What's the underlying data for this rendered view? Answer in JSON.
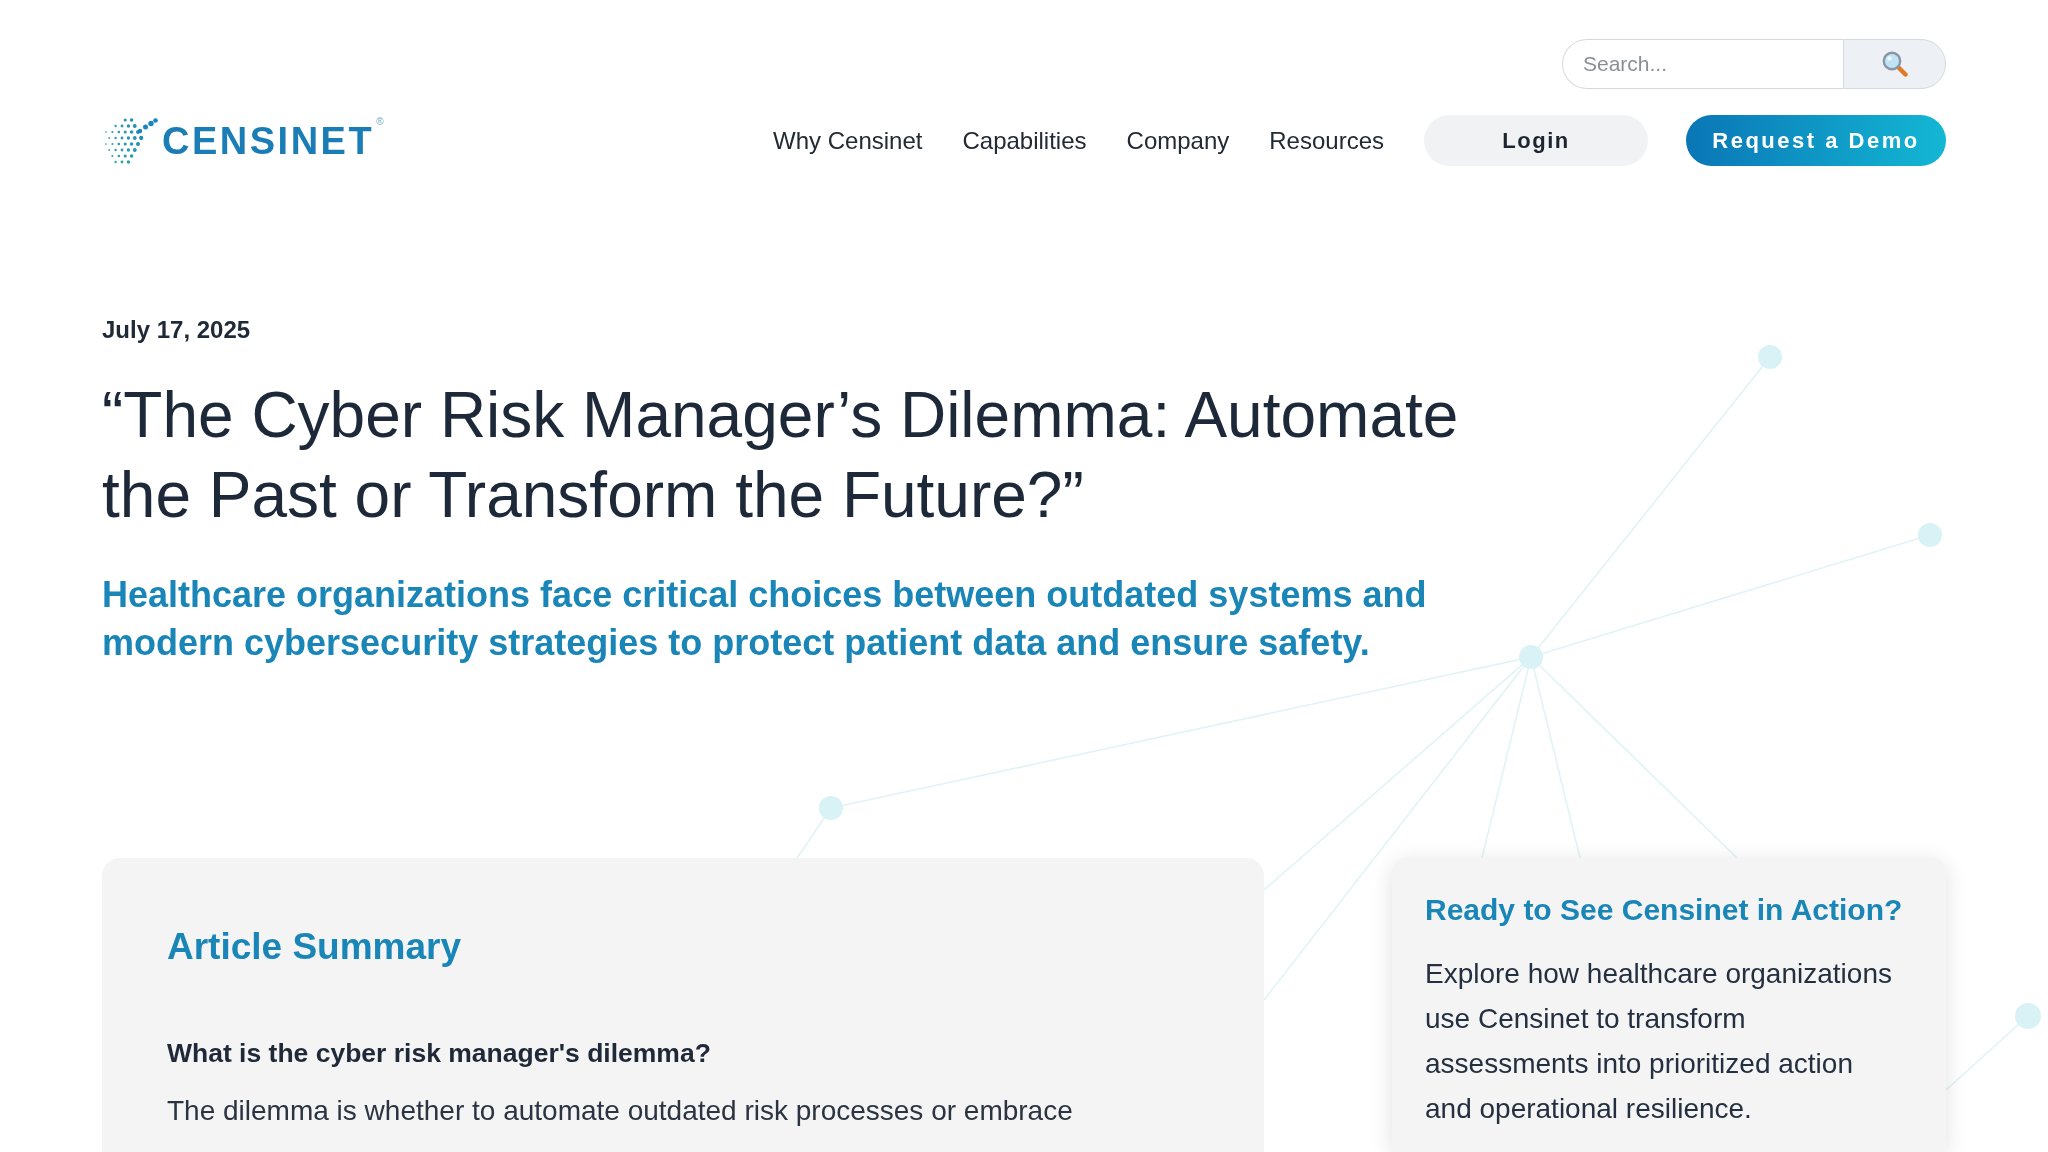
{
  "header": {
    "logo": {
      "wordmark": "CENSINET",
      "registered": "®"
    },
    "search": {
      "placeholder": "Search..."
    },
    "nav": [
      "Why Censinet",
      "Capabilities",
      "Company",
      "Resources"
    ],
    "login": "Login",
    "cta": "Request a Demo"
  },
  "article": {
    "date": "July 17, 2025",
    "title": "“The Cyber Risk Manager’s Dilemma: Automate the Past or Transform the Future?”",
    "subtitle": "Healthcare organizations face critical choices between outdated systems and modern cybersecurity strategies to protect patient data and ensure safety."
  },
  "summary": {
    "heading": "Article Summary",
    "items": [
      {
        "question": "What is the cyber risk manager's dilemma?",
        "answer": "The dilemma is whether to automate outdated risk processes or embrace"
      }
    ]
  },
  "cta_card": {
    "heading": "Ready to See Censinet in Action?",
    "text": "Explore how healthcare organizations use Censinet to transform assessments into prioritized action and operational resilience."
  }
}
